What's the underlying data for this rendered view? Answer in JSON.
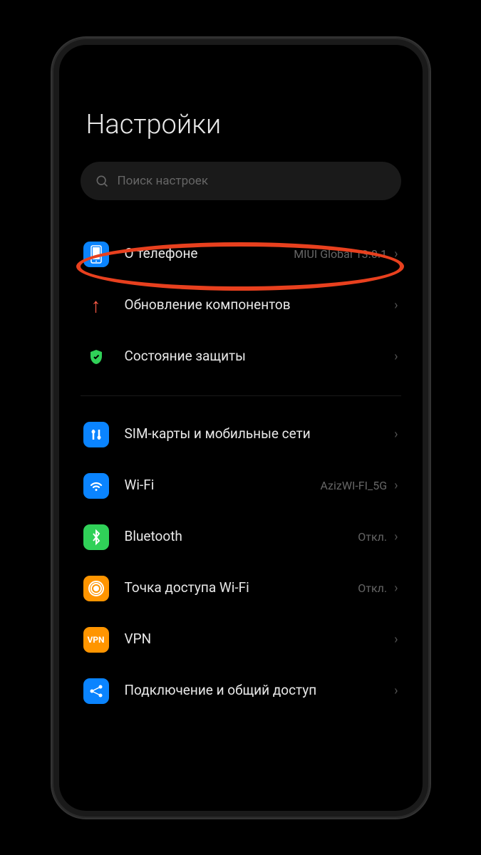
{
  "page": {
    "title": "Настройки"
  },
  "search": {
    "placeholder": "Поиск настроек"
  },
  "section1": {
    "about": {
      "label": "О телефоне",
      "value": "MIUI Global 13.0.1"
    },
    "update": {
      "label": "Обновление компонентов"
    },
    "security": {
      "label": "Состояние защиты"
    }
  },
  "section2": {
    "sim": {
      "label": "SIM-карты и мобильные сети"
    },
    "wifi": {
      "label": "Wi-Fi",
      "value": "AzizWI-FI_5G"
    },
    "bluetooth": {
      "label": "Bluetooth",
      "value": "Откл."
    },
    "hotspot": {
      "label": "Точка доступа Wi-Fi",
      "value": "Откл."
    },
    "vpn": {
      "label": "VPN"
    },
    "sharing": {
      "label": "Подключение и общий доступ"
    }
  }
}
